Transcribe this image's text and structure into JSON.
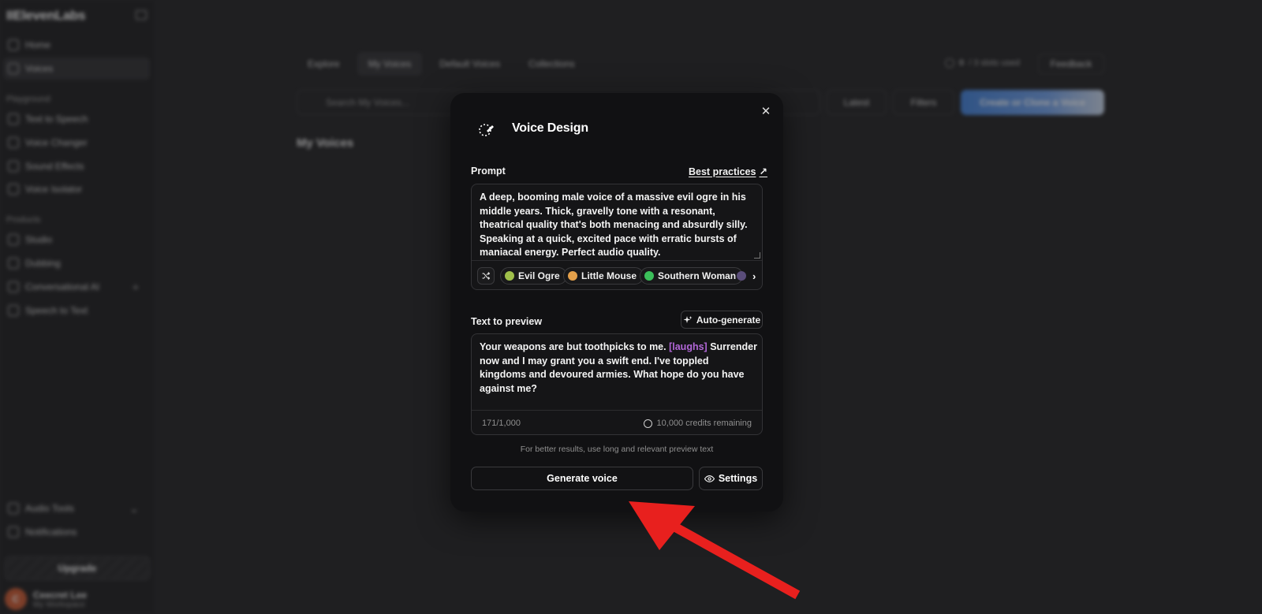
{
  "sidebar": {
    "logo": "IIElevenLabs",
    "items_top": [
      {
        "label": "Home",
        "icon": "home-icon"
      },
      {
        "label": "Voices",
        "icon": "voices-icon"
      }
    ],
    "section_playground": "Playground",
    "playground_items": [
      {
        "label": "Text to Speech"
      },
      {
        "label": "Voice Changer"
      },
      {
        "label": "Sound Effects"
      },
      {
        "label": "Voice Isolator"
      }
    ],
    "section_products": "Products",
    "product_items": [
      {
        "label": "Studio"
      },
      {
        "label": "Dubbing"
      },
      {
        "label": "Conversational AI"
      },
      {
        "label": "Speech to Text"
      }
    ],
    "audio_tools": "Audio Tools",
    "notifications": "Notifications",
    "upgrade": "Upgrade",
    "user": {
      "initial": "C",
      "name": "Ceecret Lee",
      "workspace": "My Workspace"
    }
  },
  "topnav": {
    "tabs": [
      "Explore",
      "My Voices",
      "Default Voices",
      "Collections"
    ],
    "slots_count": "0",
    "slots_text": "/ 3 slots used",
    "feedback": "Feedback"
  },
  "toolbar": {
    "search_placeholder": "Search My Voices...",
    "latest": "Latest",
    "filters": "Filters",
    "create": "Create or Clone a Voice"
  },
  "main": {
    "heading": "My Voices"
  },
  "modal": {
    "title": "Voice Design",
    "prompt_label": "Prompt",
    "best_practices": "Best practices",
    "prompt_text": "A deep, booming male voice of a massive evil ogre in his middle years. Thick, gravelly tone with a resonant, theatrical quality that's both menacing and absurdly silly. Speaking at a quick, excited pace with erratic bursts of maniacal energy. Perfect audio quality.",
    "chips": [
      {
        "label": "Evil Ogre",
        "color": "#9fbf4a"
      },
      {
        "label": "Little Mouse",
        "color": "#e4a04a"
      },
      {
        "label": "Southern Woman",
        "color": "#3bbf5a"
      }
    ],
    "preview_label": "Text to preview",
    "auto_generate": "Auto-generate",
    "preview_text_a": "Your weapons are but toothpicks to me.",
    "preview_tag": "[laughs]",
    "preview_text_b": "Surrender now and I may grant you a swift end. I've toppled kingdoms and devoured armies. What hope do you have against me?",
    "char_count": "171/1,000",
    "credits": "10,000 credits remaining",
    "hint": "For better results, use long and relevant preview text",
    "generate": "Generate voice",
    "settings": "Settings"
  },
  "colors": {
    "accent_arrow": "#e8201e",
    "tag_purple": "#b267d8"
  }
}
